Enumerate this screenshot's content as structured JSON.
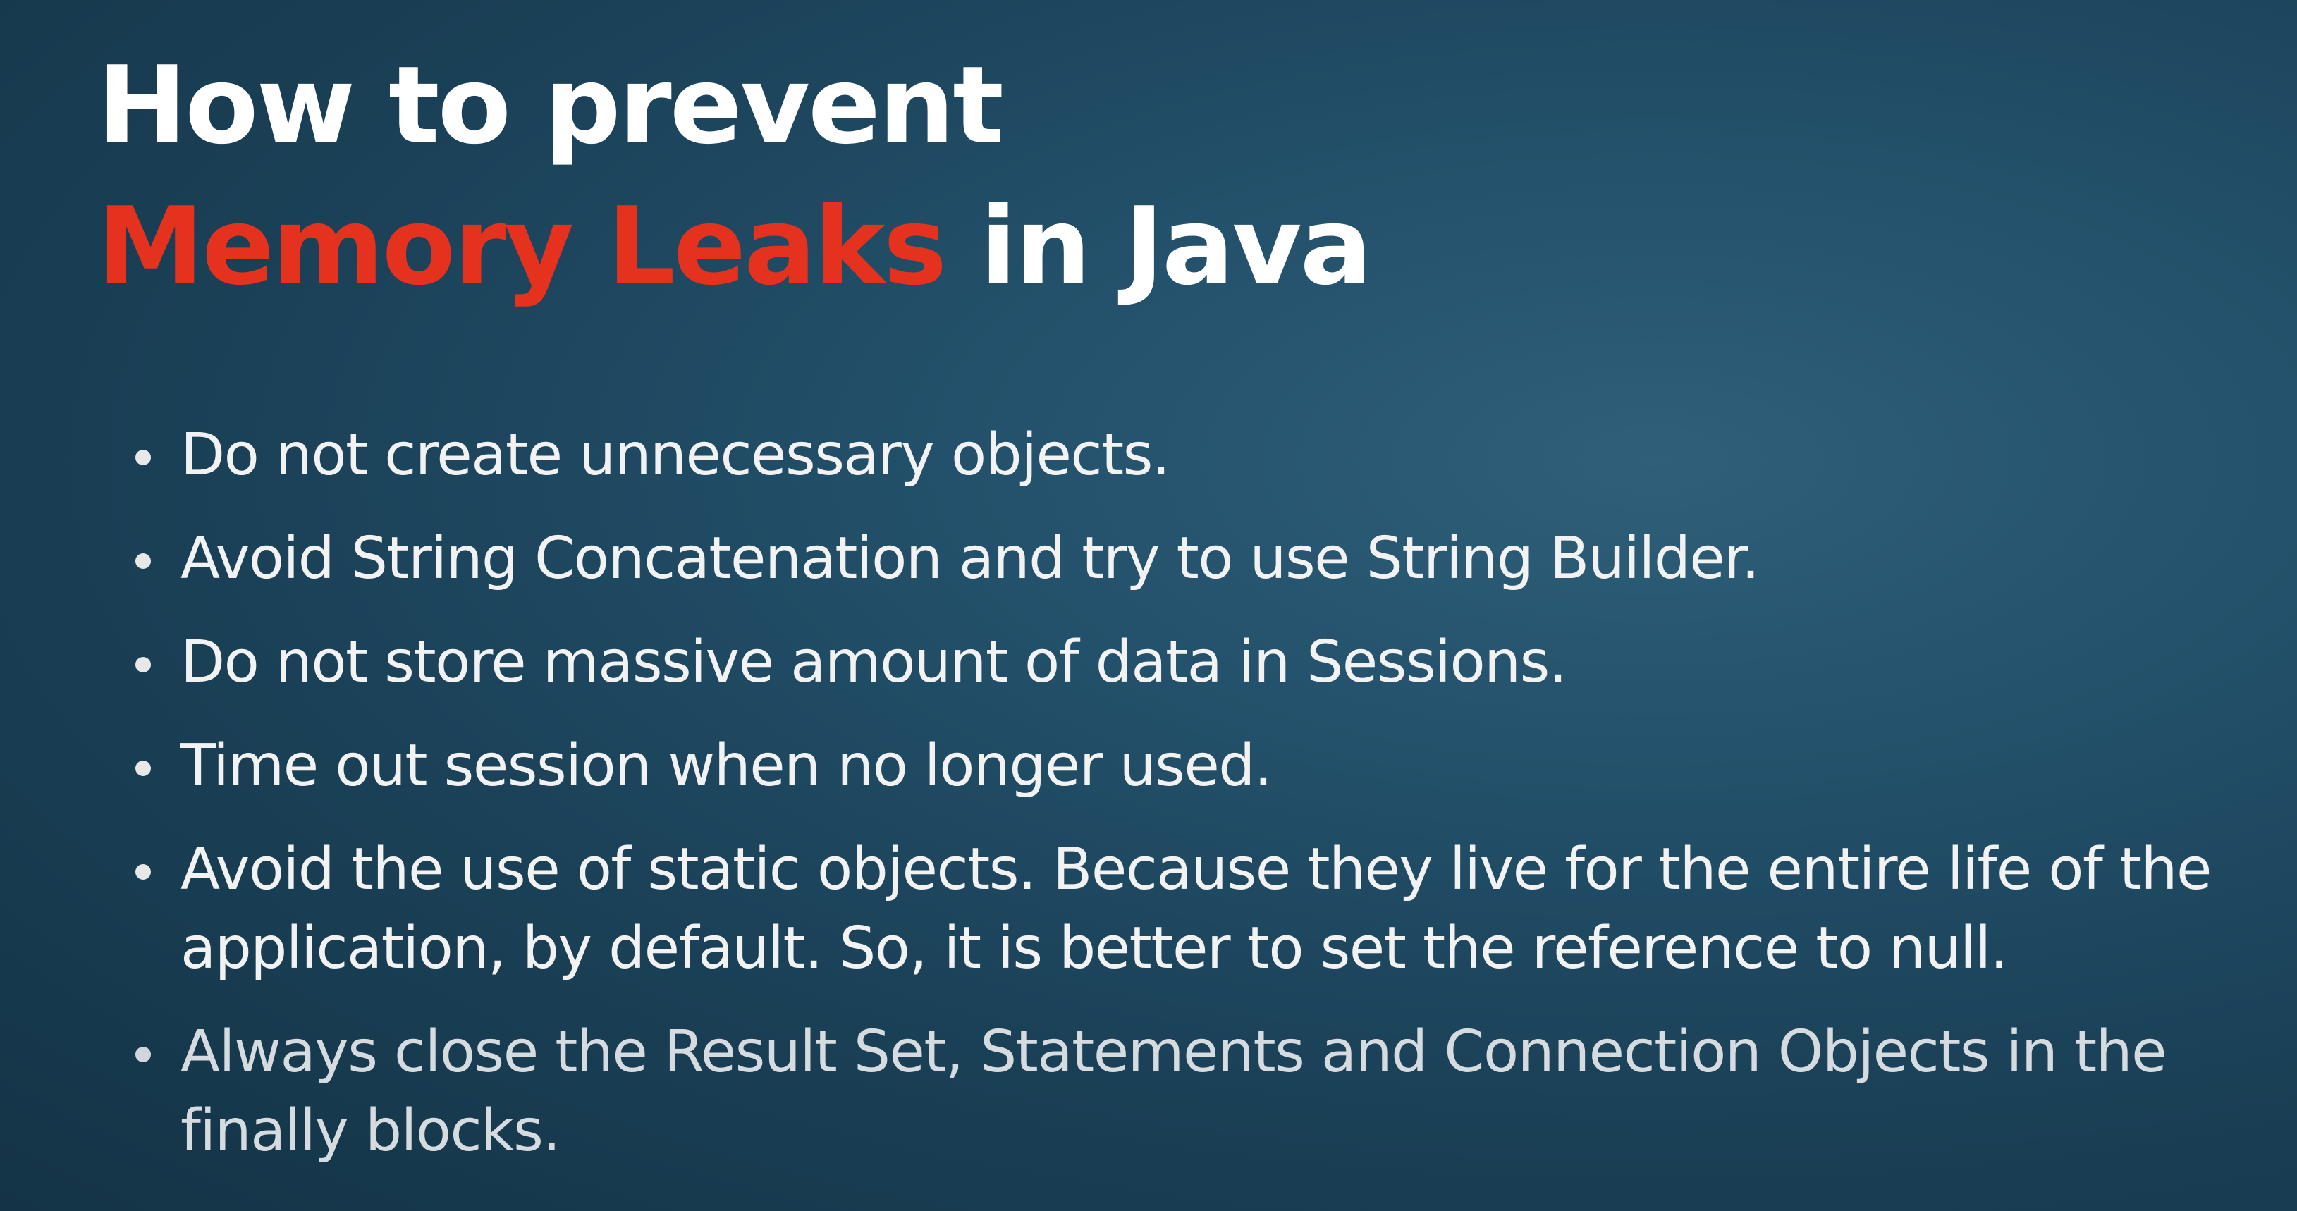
{
  "slide": {
    "title_line1": "How to prevent",
    "title_accent": "Memory Leaks",
    "title_rest": " in Java",
    "bullets": [
      "Do not create unnecessary objects.",
      "Avoid String Concatenation and try to use String Builder.",
      "Do not store massive amount of data in Sessions.",
      "Time out session when no longer used.",
      "Avoid the use of static objects. Because they live for the entire life of the application, by default. So, it is better to set the reference to null.",
      "Always close the Result Set, Statements and Connection Objects in the finally blocks."
    ]
  },
  "colors": {
    "background": "#1e4a62",
    "title": "#ffffff",
    "accent": "#e4321f",
    "bullet_text": "#f2f2f2"
  },
  "icons": {
    "bullet": "bullet-dot-icon"
  }
}
